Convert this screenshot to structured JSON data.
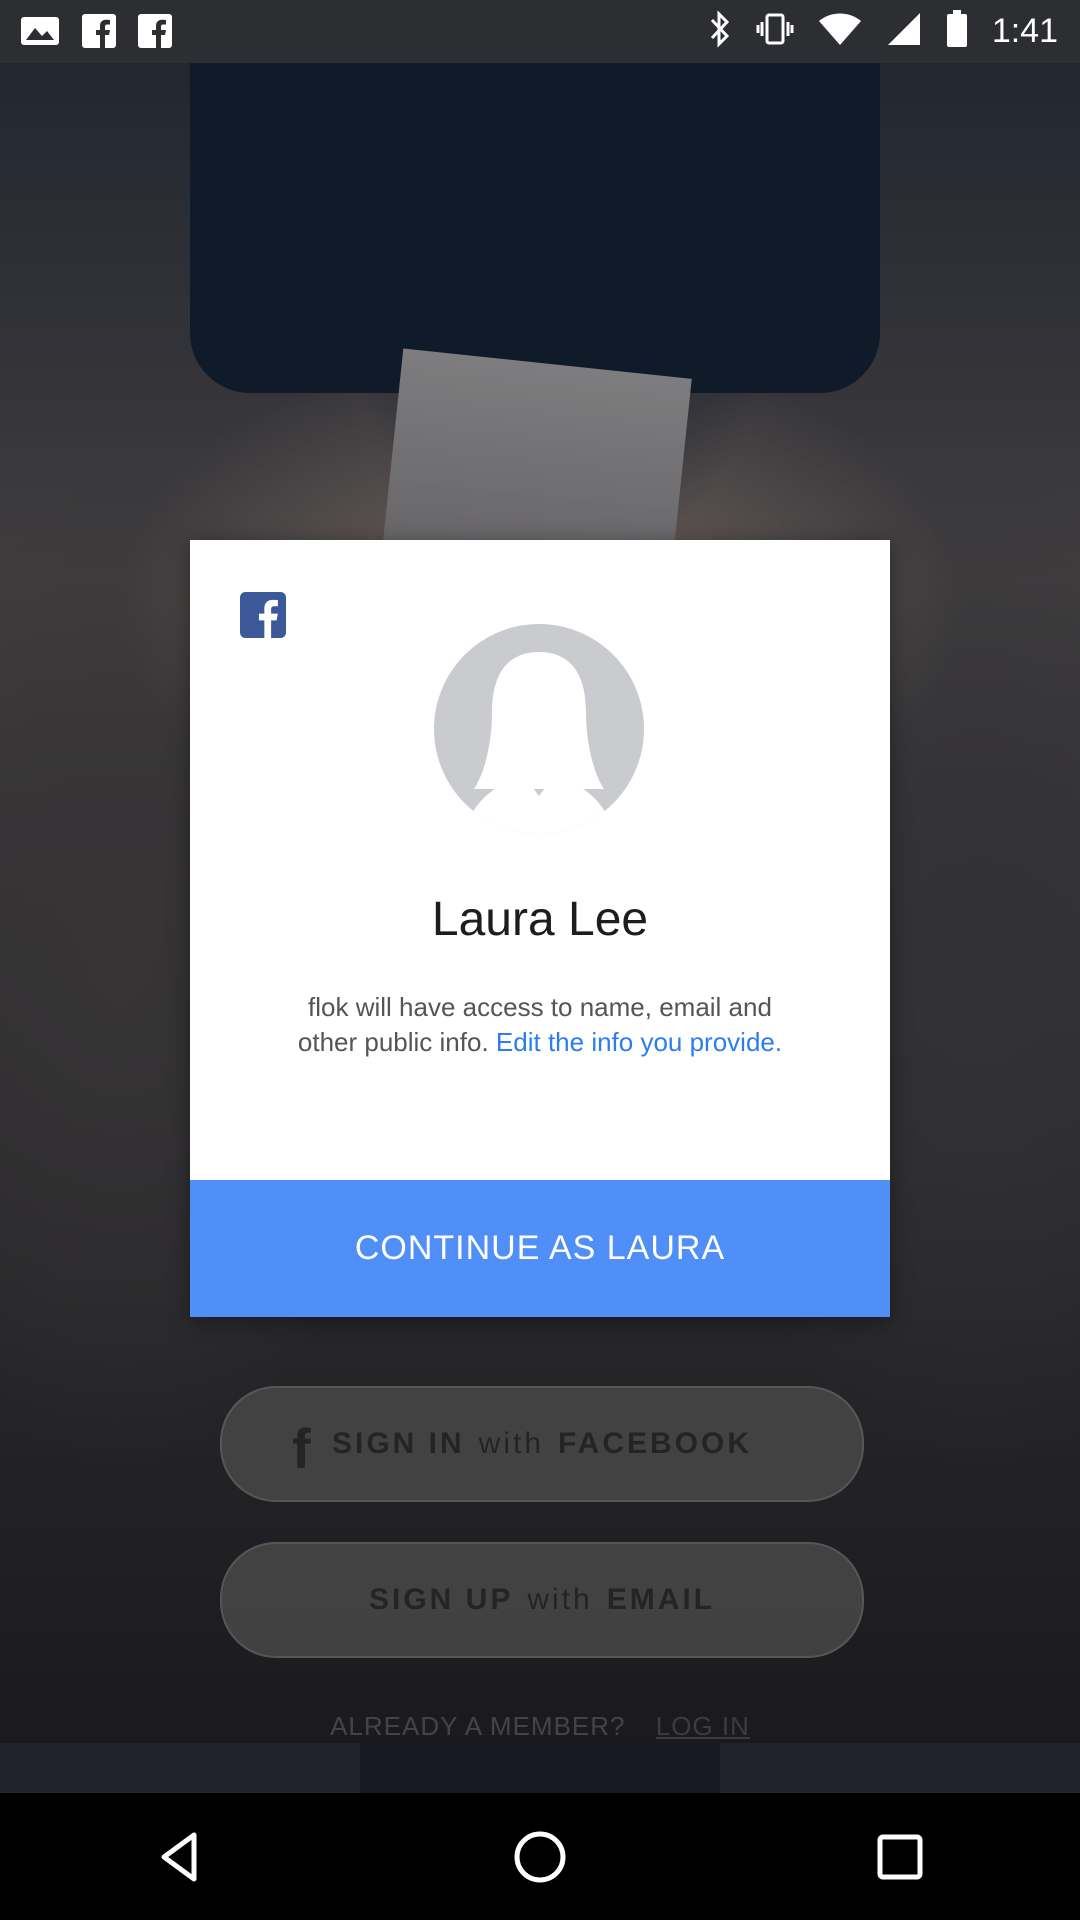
{
  "status_bar": {
    "time": "1:41",
    "icons": [
      "gallery-icon",
      "facebook-icon",
      "facebook-icon",
      "bluetooth-icon",
      "vibrate-icon",
      "wifi-icon",
      "signal-icon",
      "battery-icon"
    ]
  },
  "background": {
    "facebook_button": {
      "prefix": "SIGN IN",
      "middle": "with",
      "suffix": "FACEBOOK"
    },
    "email_button": {
      "prefix": "SIGN UP",
      "middle": "with",
      "suffix": "EMAIL"
    },
    "already_member": "ALREADY A MEMBER?",
    "log_in": "LOG IN"
  },
  "dialog": {
    "logo_icon": "facebook-icon",
    "avatar_icon": "default-avatar-icon",
    "user_name": "Laura Lee",
    "access_text": "flok will have access to name, email and other public info.",
    "edit_link": "Edit the info you provide.",
    "continue_label": "CONTINUE AS LAURA",
    "accent_color": "#4f8ff7"
  },
  "nav_bar": {
    "back_icon": "back-icon",
    "home_icon": "home-icon",
    "recents_icon": "recents-icon"
  }
}
